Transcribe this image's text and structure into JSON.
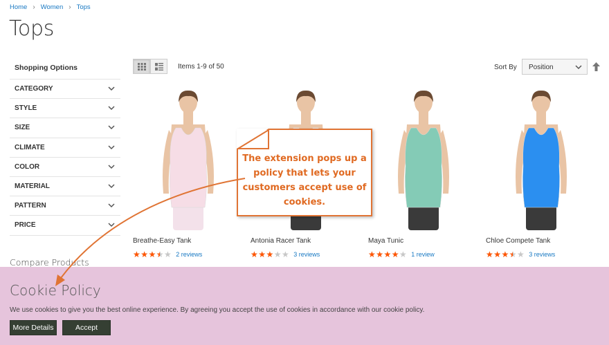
{
  "breadcrumb": [
    "Home",
    "Women",
    "Tops"
  ],
  "page_title": "Tops",
  "sidebar": {
    "title": "Shopping Options",
    "filters": [
      "CATEGORY",
      "STYLE",
      "SIZE",
      "CLIMATE",
      "COLOR",
      "MATERIAL",
      "PATTERN",
      "PRICE"
    ]
  },
  "compare_title": "Compare Products",
  "toolbar": {
    "modes": [
      "grid-icon",
      "list-icon"
    ],
    "amount": "Items 1-9 of 50",
    "sort_label": "Sort By",
    "sort_value": "Position",
    "sort_direction_icon": "arrow-up-icon"
  },
  "products": [
    {
      "name": "Breathe-Easy Tank",
      "rating": 3.5,
      "reviews": "2 reviews",
      "tank_color": "#f6dde6"
    },
    {
      "name": "Antonia Racer Tank",
      "rating": 3,
      "reviews": "3 reviews",
      "tank_color": "#f2f2f2"
    },
    {
      "name": "Maya Tunic",
      "rating": 4,
      "reviews": "1 review",
      "tank_color": "#84cbb6"
    },
    {
      "name": "Chloe Compete Tank",
      "rating": 3.5,
      "reviews": "3 reviews",
      "tank_color": "#2b8ff0"
    }
  ],
  "callout": {
    "lines": [
      "The extension pops up a",
      "policy that lets your",
      "customers accept use of",
      "cookies."
    ],
    "color": "#e07434"
  },
  "cookie": {
    "title": "Cookie Policy",
    "text": "We use cookies to give you the best online experience. By agreeing you accept the use of cookies in accordance with our cookie policy.",
    "more_label": "More Details",
    "accept_label": "Accept",
    "bar_color": "#e6c4dc",
    "button_color": "#353f33"
  },
  "colors": {
    "link": "#1979c3",
    "star": "#ff5501"
  }
}
